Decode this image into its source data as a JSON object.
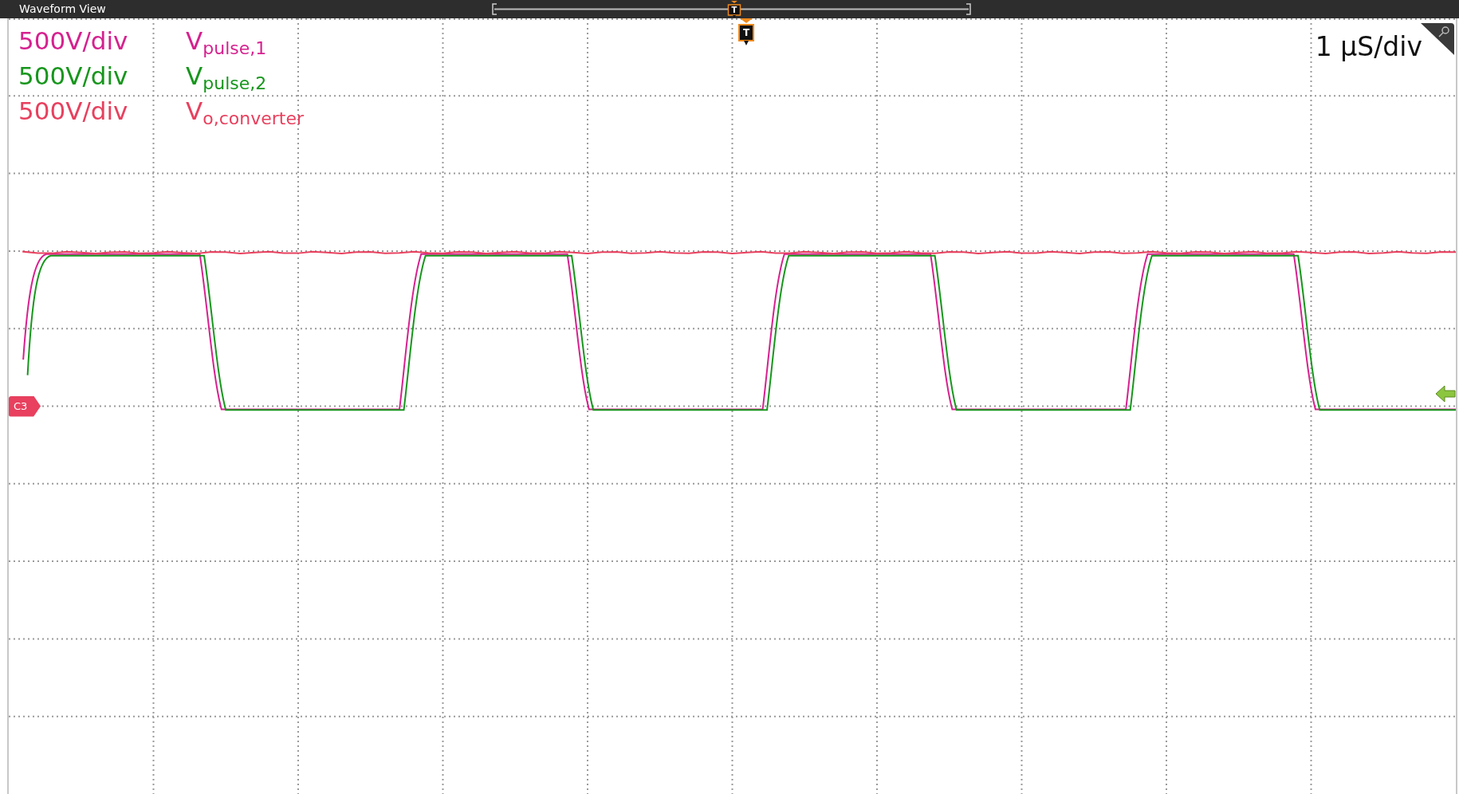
{
  "window": {
    "title": "Waveform View"
  },
  "overview": {
    "trigger_label": "T"
  },
  "trigger_marker": {
    "label": "T"
  },
  "channels": [
    {
      "scale": "500V/div",
      "name": "V$_{pulse,1}$",
      "color": "#d6218f",
      "kind": "pulse"
    },
    {
      "scale": "500V/div",
      "name": "V$_{pulse,2}$",
      "color": "#17961c",
      "kind": "pulse"
    },
    {
      "scale": "500V/div",
      "name": "V$_{o,converter}$",
      "color": "#e8405e",
      "kind": "flat"
    }
  ],
  "timebase": "1 μS/div",
  "channel_marker": {
    "label": "C3"
  }
}
